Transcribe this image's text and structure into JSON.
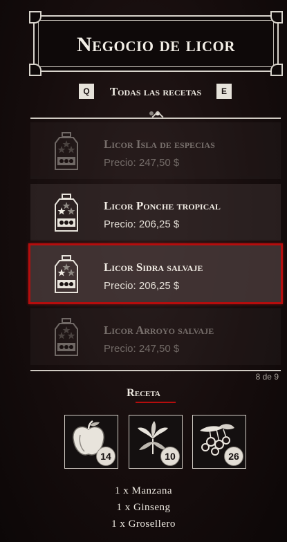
{
  "header": {
    "title": "Negocio de licor"
  },
  "category": {
    "prev_key": "Q",
    "next_key": "E",
    "label": "Todas las recetas"
  },
  "recipes": [
    {
      "name": "Licor Isla de especias",
      "price": "Precio: 247,50 $",
      "state": "dimmed"
    },
    {
      "name": "Licor Ponche tropical",
      "price": "Precio: 206,25 $",
      "state": "normal"
    },
    {
      "name": "Licor Sidra salvaje",
      "price": "Precio: 206,25 $",
      "state": "selected"
    },
    {
      "name": "Licor Arroyo salvaje",
      "price": "Precio: 247,50 $",
      "state": "dimmed"
    }
  ],
  "list_counter": "8 de 9",
  "recipe": {
    "heading": "Receta",
    "ingredients": [
      {
        "icon": "apple-icon",
        "count": "14",
        "line": "1 x Manzana"
      },
      {
        "icon": "ginseng-icon",
        "count": "10",
        "line": "1 x Ginseng"
      },
      {
        "icon": "currant-icon",
        "count": "26",
        "line": "1 x Grosellero"
      }
    ]
  },
  "colors": {
    "selection_border": "#b50d0d",
    "accent_underline": "#b50d0d",
    "background": "#160d0d"
  }
}
